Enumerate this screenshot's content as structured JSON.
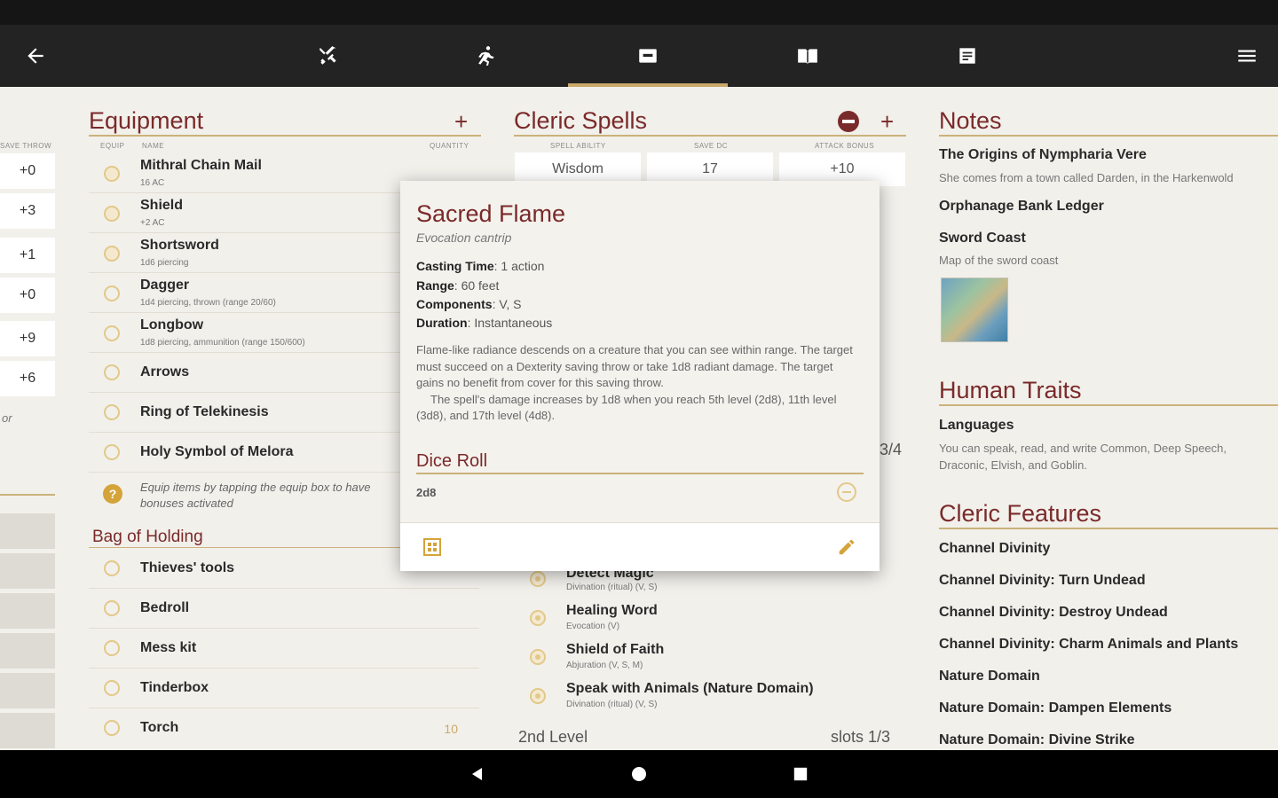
{
  "toolbar": {
    "icons": [
      "back-arrow",
      "crossed-swords",
      "running-figure",
      "id-card",
      "open-book",
      "notes",
      "menu"
    ]
  },
  "left_strip": {
    "header": "SAVE THROW",
    "values": [
      "+0",
      "+3",
      "+1",
      "+0",
      "+9",
      "+6"
    ],
    "fragment": "or"
  },
  "equipment": {
    "title": "Equipment",
    "col_equip": "EQUIP",
    "col_name": "NAME",
    "col_qty": "QUANTITY",
    "items": [
      {
        "name": "Mithral Chain Mail",
        "sub": "16 AC"
      },
      {
        "name": "Shield",
        "sub": "+2 AC"
      },
      {
        "name": "Shortsword",
        "sub": "1d6 piercing"
      },
      {
        "name": "Dagger",
        "sub": "1d4 piercing, thrown (range 20/60)"
      },
      {
        "name": "Longbow",
        "sub": "1d8 piercing, ammunition (range 150/600)"
      },
      {
        "name": "Arrows",
        "sub": ""
      },
      {
        "name": "Ring of Telekinesis",
        "sub": ""
      },
      {
        "name": "Holy Symbol of Melora",
        "sub": ""
      }
    ],
    "hint": "Equip items by tapping the equip box to have bonuses activated",
    "bag": {
      "title": "Bag of Holding",
      "items": [
        {
          "name": "Thieves' tools",
          "qty": ""
        },
        {
          "name": "Bedroll",
          "qty": ""
        },
        {
          "name": "Mess kit",
          "qty": ""
        },
        {
          "name": "Tinderbox",
          "qty": ""
        },
        {
          "name": "Torch",
          "qty": "10"
        }
      ]
    }
  },
  "spells": {
    "title": "Cleric Spells",
    "col_ability": "SPELL ABILITY",
    "col_dc": "SAVE DC",
    "col_attack": "ATTACK BONUS",
    "ability": "Wisdom",
    "dc": "17",
    "attack": "+10",
    "slots_partial": "3/4",
    "items": [
      {
        "name": "Detect Magic",
        "sub": "Divination (ritual) (V, S)"
      },
      {
        "name": "Healing Word",
        "sub": "Evocation (V)"
      },
      {
        "name": "Shield of Faith",
        "sub": "Abjuration (V, S, M)"
      },
      {
        "name": "Speak with Animals (Nature Domain)",
        "sub": "Divination (ritual) (V, S)"
      }
    ],
    "level2": "2nd Level",
    "level2_slots": "slots 1/3"
  },
  "popup": {
    "title": "Sacred Flame",
    "type": "Evocation cantrip",
    "casting_time_label": "Casting Time",
    "casting_time": ": 1 action",
    "range_label": "Range",
    "range": ": 60 feet",
    "components_label": "Components",
    "components": ": V, S",
    "duration_label": "Duration",
    "duration": ": Instantaneous",
    "desc1": "Flame-like radiance descends on a creature that you can see within range. The target must succeed on a Dexterity saving throw or take 1d8 radiant damage. The target gains no benefit from cover for this saving throw.",
    "desc2": "The spell's damage increases by 1d8 when you reach 5th level (2d8), 11th level (3d8), and 17th level (4d8).",
    "dice_title": "Dice Roll",
    "dice_value": "2d8"
  },
  "notes": {
    "title": "Notes",
    "items": [
      {
        "title": "The Origins of Nympharia Vere",
        "sub": "She comes from a town called Darden, in the Harkenwold"
      },
      {
        "title": "Orphanage Bank Ledger",
        "sub": ""
      },
      {
        "title": "Sword Coast",
        "sub": "Map of the sword coast"
      }
    ]
  },
  "traits": {
    "title": "Human Traits",
    "label": "Languages",
    "text": "You can speak, read, and write Common, Deep Speech, Draconic, Elvish, and Goblin."
  },
  "features": {
    "title": "Cleric Features",
    "items": [
      "Channel Divinity",
      "Channel Divinity: Turn Undead",
      "Channel Divinity: Destroy Undead",
      "Channel Divinity: Charm Animals and Plants",
      "Nature Domain",
      "Nature Domain: Dampen Elements",
      "Nature Domain: Divine Strike"
    ]
  },
  "colors": {
    "accent": "#7a2a2a",
    "gold": "#cbb27a",
    "toolbar": "#232323",
    "background": "#f2f0eb"
  }
}
